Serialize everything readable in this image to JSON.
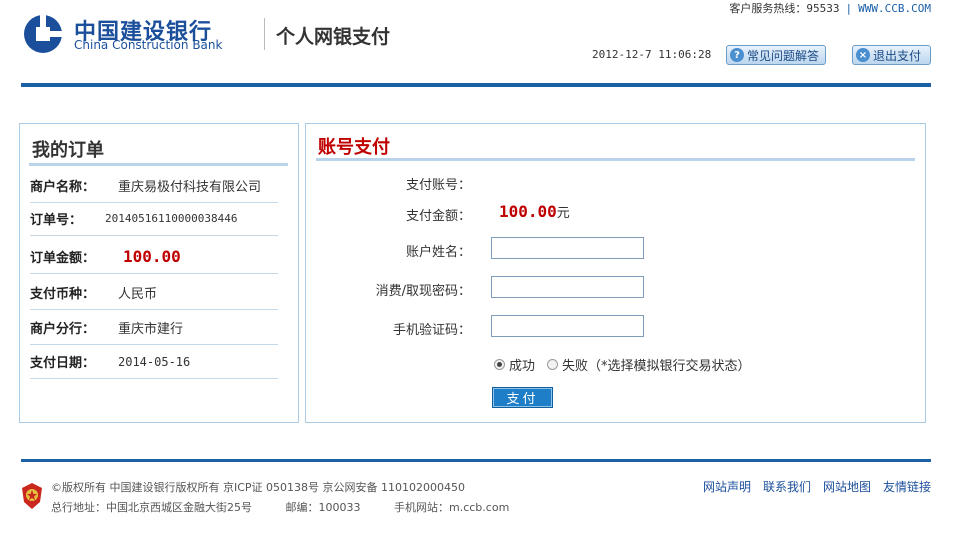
{
  "top": {
    "hotline": "客户服务热线：95533",
    "separator": "|",
    "website": "WWW.CCB.COM"
  },
  "brand": {
    "name_cn": "中国建设银行",
    "name_en": "China Construction Bank",
    "portal": "个人网银支付",
    "color": "#1b4f9c"
  },
  "header": {
    "datetime": "2012-12-7 11:06:28",
    "faq_label": "常见问题解答",
    "exit_label": "退出支付"
  },
  "order": {
    "title": "我的订单",
    "rows": [
      {
        "label": "商户名称：",
        "value": "重庆易极付科技有限公司"
      },
      {
        "label": "订单号：",
        "value": "20140516110000038446"
      },
      {
        "label": "订单金额：",
        "value": "100.00"
      },
      {
        "label": "支付币种：",
        "value": "人民币"
      },
      {
        "label": "商户分行：",
        "value": "重庆市建行"
      },
      {
        "label": "支付日期：",
        "value": "2014-05-16"
      }
    ]
  },
  "payment": {
    "title": "账号支付",
    "account_label": "支付账号：",
    "amount_label": "支付金额：",
    "amount_value": "100.00",
    "amount_unit": "元",
    "name_label": "账户姓名：",
    "name_value": "",
    "password_label": "消费/取现密码：",
    "password_value": "",
    "sms_label": "手机验证码：",
    "sms_value": "",
    "success_label": "成功",
    "fail_label": "失败（*选择模拟银行交易状态）",
    "selected_status": "成功",
    "pay_button": "支付",
    "accent": "#c00000"
  },
  "footer": {
    "line1": "©版权所有 中国建设银行版权所有 京ICP证 050138号 京公网安备 110102000450",
    "addr": "总行地址：中国北京西城区金融大街25号",
    "postcode": "邮编：100033",
    "mobile": "手机网站：m.ccb.com",
    "links": [
      "网站声明",
      "联系我们",
      "网站地图",
      "友情链接"
    ]
  }
}
